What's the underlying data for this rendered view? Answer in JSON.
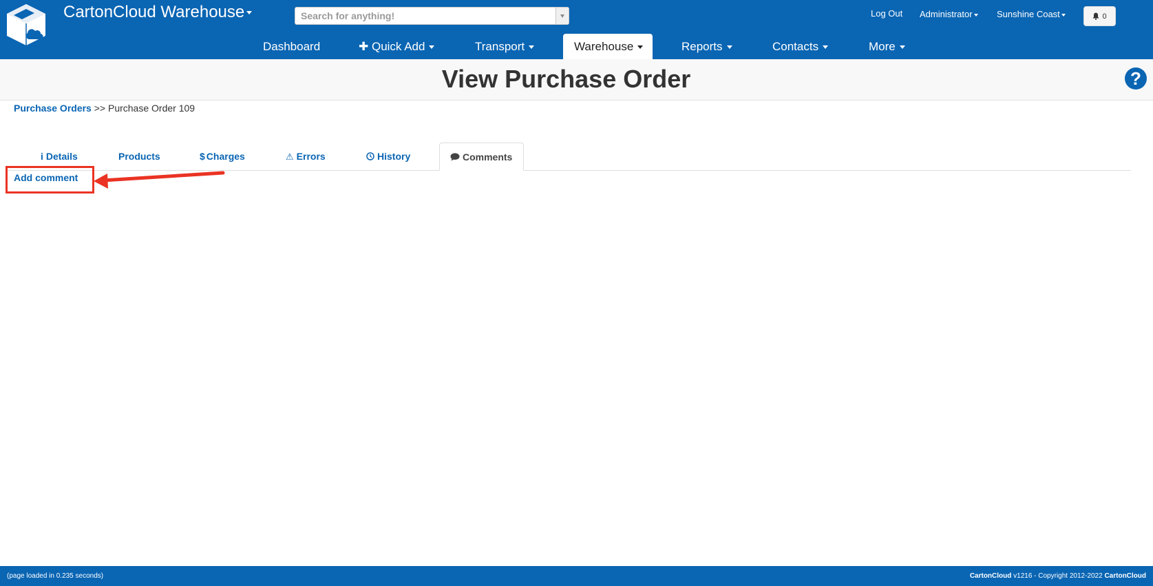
{
  "header": {
    "app_title": "CartonCloud Warehouse",
    "search_placeholder": "Search for anything!",
    "logout": "Log Out",
    "user_menu": "Administrator",
    "location_menu": "Sunshine Coast",
    "notification_count": "0"
  },
  "nav": {
    "items": [
      {
        "label": "Dashboard",
        "dropdown": false,
        "icon": ""
      },
      {
        "label": "Quick Add",
        "dropdown": true,
        "icon": "plus-icon"
      },
      {
        "label": "Transport",
        "dropdown": true,
        "icon": ""
      },
      {
        "label": "Warehouse",
        "dropdown": true,
        "icon": "",
        "active": true
      },
      {
        "label": "Reports",
        "dropdown": true,
        "icon": ""
      },
      {
        "label": "Contacts",
        "dropdown": true,
        "icon": ""
      },
      {
        "label": "More",
        "dropdown": true,
        "icon": ""
      }
    ]
  },
  "page": {
    "title": "View Purchase Order",
    "help_icon": "question-icon",
    "breadcrumb": {
      "link": "Purchase Orders",
      "separator": ">>",
      "current": "Purchase Order 109"
    }
  },
  "tabs": [
    {
      "label": "Details",
      "icon": "info-icon",
      "glyph": "i"
    },
    {
      "label": "Products",
      "icon": "",
      "glyph": ""
    },
    {
      "label": "Charges",
      "icon": "dollar-icon",
      "glyph": "$"
    },
    {
      "label": "Errors",
      "icon": "warning-icon",
      "glyph": "⚠"
    },
    {
      "label": "History",
      "icon": "clock-icon",
      "glyph": "⊙"
    },
    {
      "label": "Comments",
      "icon": "comment-icon",
      "glyph": "💬",
      "active": true
    }
  ],
  "content": {
    "add_comment": "Add comment"
  },
  "annotation": {
    "highlight_color": "#ea3323"
  },
  "footer": {
    "load_time": "(page loaded in 0.235 seconds)",
    "brand": "CartonCloud",
    "version_copyright": "v1216 - Copyright 2012-2022",
    "brand2": "CartonCloud"
  },
  "colors": {
    "brand_blue": "#0a65b3"
  }
}
